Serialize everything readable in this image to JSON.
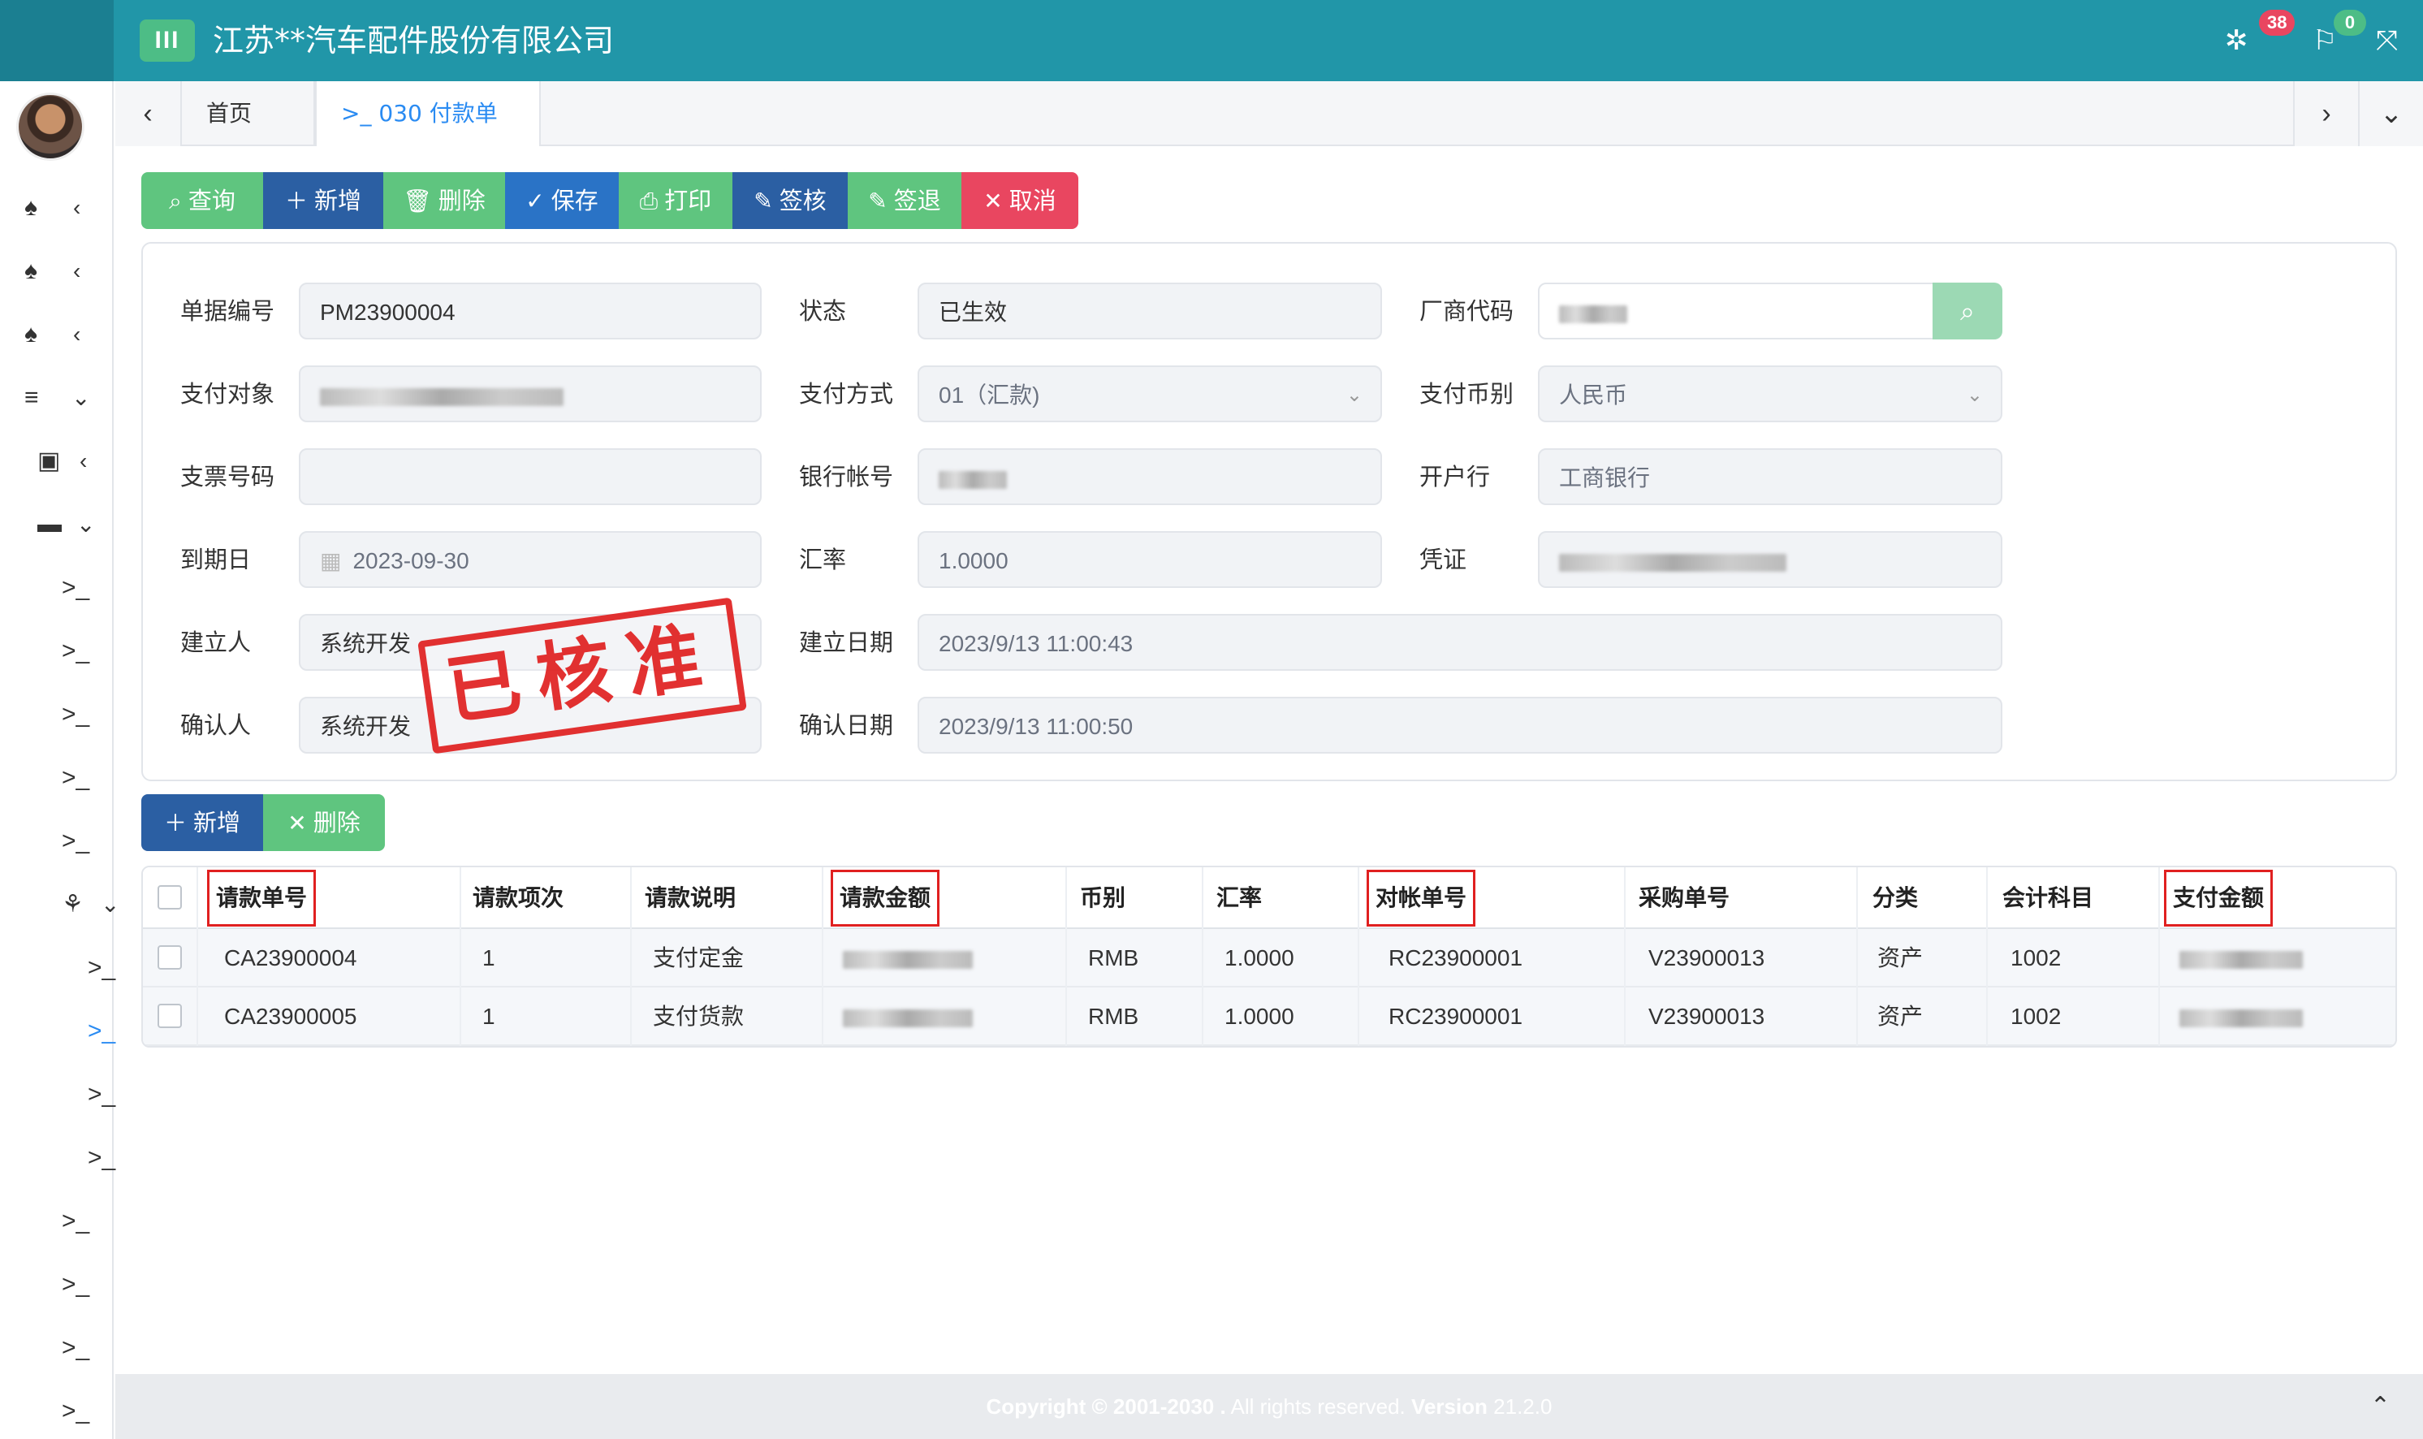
{
  "header": {
    "menu_icon": "III",
    "company": "江苏**汽车配件股份有限公司",
    "badge_settings": "38",
    "badge_flag": "0"
  },
  "tabs": {
    "home": "首页",
    "active": "030 付款单"
  },
  "toolbar": {
    "query": "查询",
    "add": "新增",
    "delete": "删除",
    "save": "保存",
    "print": "打印",
    "sign": "签核",
    "unsign": "签退",
    "cancel": "取消"
  },
  "form": {
    "doc_no_label": "单据编号",
    "doc_no": "PM23900004",
    "status_label": "状态",
    "status": "已生效",
    "vendor_code_label": "厂商代码",
    "pay_target_label": "支付对象",
    "pay_method_label": "支付方式",
    "pay_method": "01（汇款)",
    "currency_label": "支付币别",
    "currency": "人民币",
    "cheque_label": "支票号码",
    "cheque": "",
    "bank_acct_label": "银行帐号",
    "bank_label": "开户行",
    "bank": "工商银行",
    "due_label": "到期日",
    "due": "2023-09-30",
    "rate_label": "汇率",
    "rate": "1.0000",
    "voucher_label": "凭证",
    "creator_label": "建立人",
    "creator": "系统开发",
    "create_date_label": "建立日期",
    "create_date": "2023/9/13 11:00:43",
    "confirmer_label": "确认人",
    "confirmer": "系统开发",
    "confirm_date_label": "确认日期",
    "confirm_date": "2023/9/13 11:00:50",
    "stamp": "已核准"
  },
  "detail_toolbar": {
    "add": "新增",
    "delete": "删除"
  },
  "table": {
    "headers": [
      "请款单号",
      "请款项次",
      "请款说明",
      "请款金额",
      "币别",
      "汇率",
      "对帐单号",
      "采购单号",
      "分类",
      "会计科目",
      "支付金额"
    ],
    "rows": [
      [
        "CA23900004",
        "1",
        "支付定金",
        "",
        "RMB",
        "1.0000",
        "RC23900001",
        "V23900013",
        "资产",
        "1002",
        ""
      ],
      [
        "CA23900005",
        "1",
        "支付货款",
        "",
        "RMB",
        "1.0000",
        "RC23900001",
        "V23900013",
        "资产",
        "1002",
        ""
      ]
    ]
  },
  "footer": {
    "copyright": "Copyright © 2001-2030 .",
    "rights": " All rights reserved. ",
    "version_label": "Version",
    "version": " 21.2.0"
  },
  "colors": {
    "header": "#2196a8",
    "green": "#5fc57f",
    "blue": "#2a73c6",
    "red": "#e94660",
    "stamp": "#e02020"
  }
}
